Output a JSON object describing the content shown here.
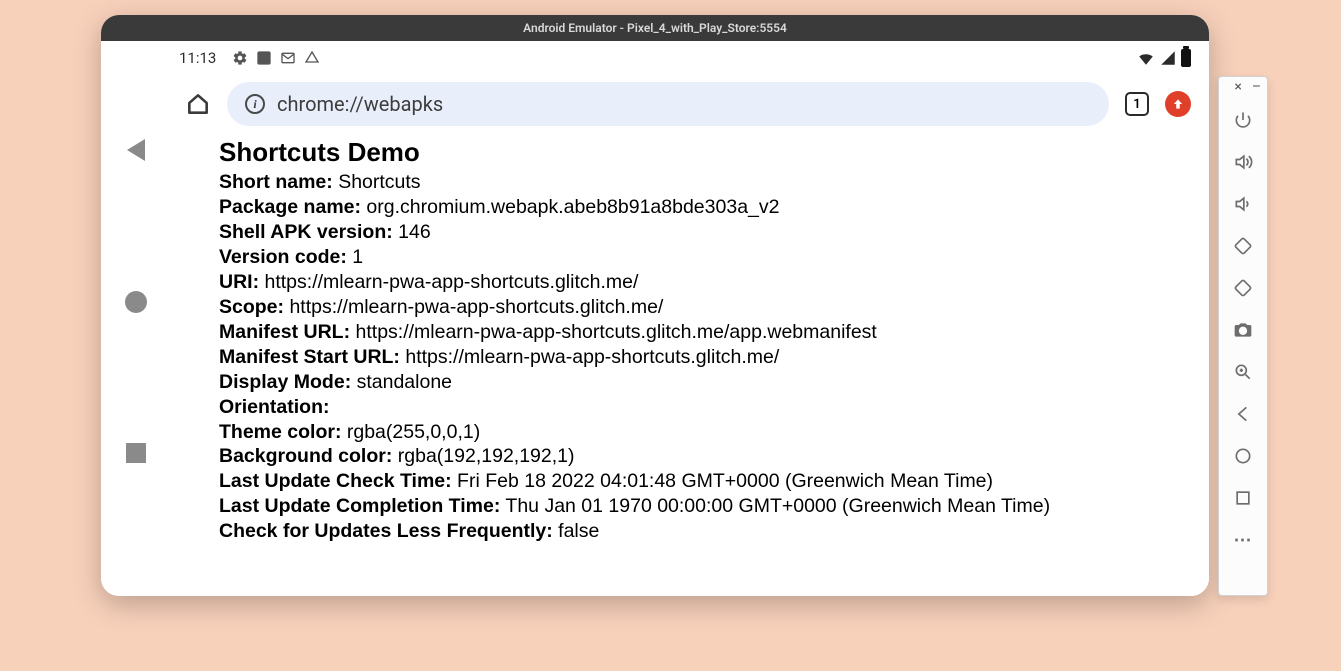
{
  "emulator": {
    "title": "Android Emulator - Pixel_4_with_Play_Store:5554"
  },
  "status": {
    "time": "11:13"
  },
  "omnibox": {
    "url": "chrome://webapks",
    "tab_count": "1"
  },
  "page": {
    "title": "Shortcuts Demo",
    "rows": [
      {
        "k": "Short name:",
        "v": "Shortcuts"
      },
      {
        "k": "Package name:",
        "v": "org.chromium.webapk.abeb8b91a8bde303a_v2"
      },
      {
        "k": "Shell APK version:",
        "v": "146"
      },
      {
        "k": "Version code:",
        "v": "1"
      },
      {
        "k": "URI:",
        "v": "https://mlearn-pwa-app-shortcuts.glitch.me/"
      },
      {
        "k": "Scope:",
        "v": "https://mlearn-pwa-app-shortcuts.glitch.me/"
      },
      {
        "k": "Manifest URL:",
        "v": "https://mlearn-pwa-app-shortcuts.glitch.me/app.webmanifest"
      },
      {
        "k": "Manifest Start URL:",
        "v": "https://mlearn-pwa-app-shortcuts.glitch.me/"
      },
      {
        "k": "Display Mode:",
        "v": "standalone"
      },
      {
        "k": "Orientation:",
        "v": ""
      },
      {
        "k": "Theme color:",
        "v": "rgba(255,0,0,1)"
      },
      {
        "k": "Background color:",
        "v": "rgba(192,192,192,1)"
      },
      {
        "k": "Last Update Check Time:",
        "v": "Fri Feb 18 2022 04:01:48 GMT+0000 (Greenwich Mean Time)"
      },
      {
        "k": "Last Update Completion Time:",
        "v": "Thu Jan 01 1970 00:00:00 GMT+0000 (Greenwich Mean Time)"
      },
      {
        "k": "Check for Updates Less Frequently:",
        "v": "false"
      }
    ]
  },
  "panel": {
    "close": "×",
    "min": "–"
  }
}
